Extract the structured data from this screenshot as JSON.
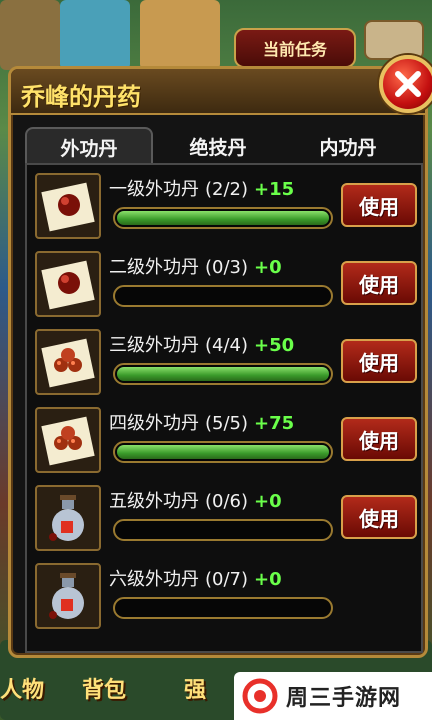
{
  "top": {
    "task_label": "当前任务"
  },
  "dialog": {
    "title": "乔峰的丹药",
    "tabs": [
      {
        "label": "外功丹"
      },
      {
        "label": "绝技丹"
      },
      {
        "label": "内功丹"
      }
    ],
    "items": [
      {
        "name": "一级外功丹",
        "count": "(2/2)",
        "bonus": "+15",
        "progress": 1.0,
        "button": "使用",
        "icon": "single-pill-icon"
      },
      {
        "name": "二级外功丹",
        "count": "(0/3)",
        "bonus": "+0",
        "progress": 0.0,
        "button": "使用",
        "icon": "single-pill-icon"
      },
      {
        "name": "三级外功丹",
        "count": "(4/4)",
        "bonus": "+50",
        "progress": 1.0,
        "button": "使用",
        "icon": "pill-pile-icon"
      },
      {
        "name": "四级外功丹",
        "count": "(5/5)",
        "bonus": "+75",
        "progress": 1.0,
        "button": "使用",
        "icon": "pill-pile-icon"
      },
      {
        "name": "五级外功丹",
        "count": "(0/6)",
        "bonus": "+0",
        "progress": 0.0,
        "button": "使用",
        "icon": "potion-bottle-icon"
      },
      {
        "name": "六级外功丹",
        "count": "(0/7)",
        "bonus": "+0",
        "progress": 0.0,
        "button": "",
        "icon": "potion-bottle-icon"
      }
    ]
  },
  "bottom_nav": {
    "items": [
      {
        "label": "人物"
      },
      {
        "label": "背包"
      },
      {
        "label": "强"
      }
    ]
  },
  "watermark": {
    "text": "周三手游网"
  },
  "colors": {
    "accent_gold": "#b58a3a",
    "title_yellow": "#ffe26a",
    "bonus_green": "#6aff4a",
    "button_red": "#b22a1a",
    "bar_green": "#3a9a2a"
  }
}
